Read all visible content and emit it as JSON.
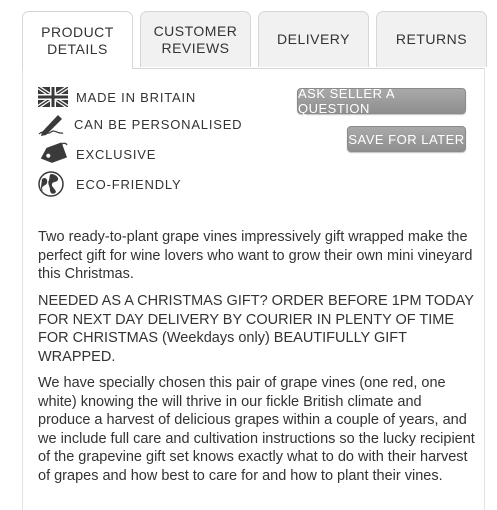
{
  "tabs": [
    {
      "label": "PRODUCT\nDETAILS"
    },
    {
      "label": "CUSTOMER\nREVIEWS"
    },
    {
      "label": "DELIVERY"
    },
    {
      "label": "RETURNS"
    }
  ],
  "features": [
    {
      "icon": "union-jack-flag-icon",
      "label": "MADE IN BRITAIN"
    },
    {
      "icon": "pen-icon",
      "label": "CAN BE PERSONALISED"
    },
    {
      "icon": "gift-tag-icon",
      "label": "EXCLUSIVE"
    },
    {
      "icon": "globe-icon",
      "label": "ECO-FRIENDLY"
    }
  ],
  "buttons": {
    "ask_seller": "ASK SELLER A QUESTION",
    "save_for_later": "SAVE FOR LATER"
  },
  "description": {
    "intro": "Two ready-to-plant grape vines impressively gift wrapped make the perfect gift for wine lovers who want to grow their own mini vineyard this Christmas.",
    "notice": "NEEDED AS A CHRISTMAS GIFT? ORDER BEFORE 1PM TODAY FOR NEXT DAY DELIVERY BY COURIER IN PLENTY OF TIME FOR CHRISTMAS (Weekdays only) BEAUTIFULLY GIFT WRAPPED.",
    "details": "We have specially chosen this pair of grape vines (one red, one white) knowing the will thrive in our fickle British climate and produce a harvest of delicious grapes within a couple of years, and we include full care and cultivation instructions so the lucky recipient of the grapevine gift set knows exactly what to do with their harvest of grapes and how best to care for and how to plant their vines."
  },
  "colors": {
    "button_bg": "#999999",
    "tab_inactive_bg": "#f1f1f1",
    "border": "#d6d6d6"
  }
}
